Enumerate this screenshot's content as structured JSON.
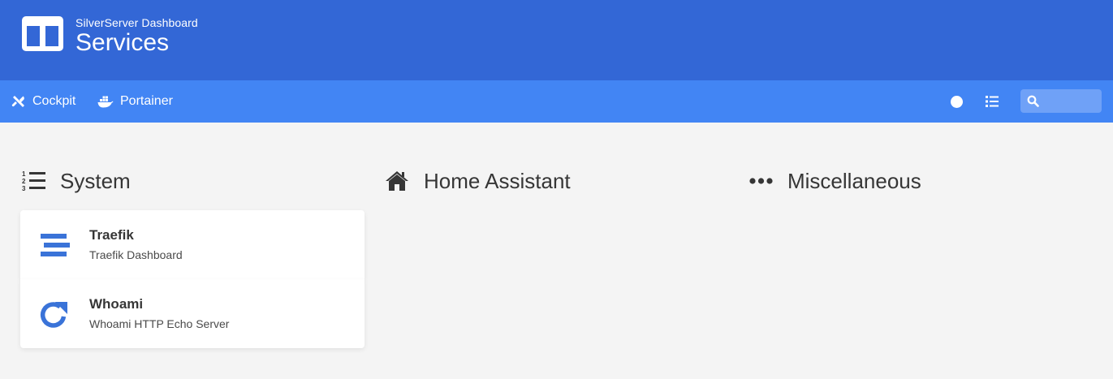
{
  "header": {
    "subtitle": "SilverServer Dashboard",
    "title": "Services",
    "logo_icon": "columns-icon",
    "color": "#3367d6"
  },
  "navbar": {
    "color": "#4285f4",
    "links": [
      {
        "label": "Cockpit",
        "icon": "tools-icon"
      },
      {
        "label": "Portainer",
        "icon": "docker-icon"
      }
    ],
    "search": {
      "placeholder": "",
      "value": ""
    }
  },
  "groups": [
    {
      "name": "System",
      "icon": "list-ol-icon",
      "items": [
        {
          "name": "Traefik",
          "subtitle": "Traefik Dashboard",
          "icon": "traefik-icon"
        },
        {
          "name": "Whoami",
          "subtitle": "Whoami HTTP Echo Server",
          "icon": "redo-icon"
        }
      ]
    },
    {
      "name": "Home Assistant",
      "icon": "home-icon",
      "items": []
    },
    {
      "name": "Miscellaneous",
      "icon": "ellipsis-icon",
      "items": []
    }
  ],
  "accent": "#3a73d8"
}
